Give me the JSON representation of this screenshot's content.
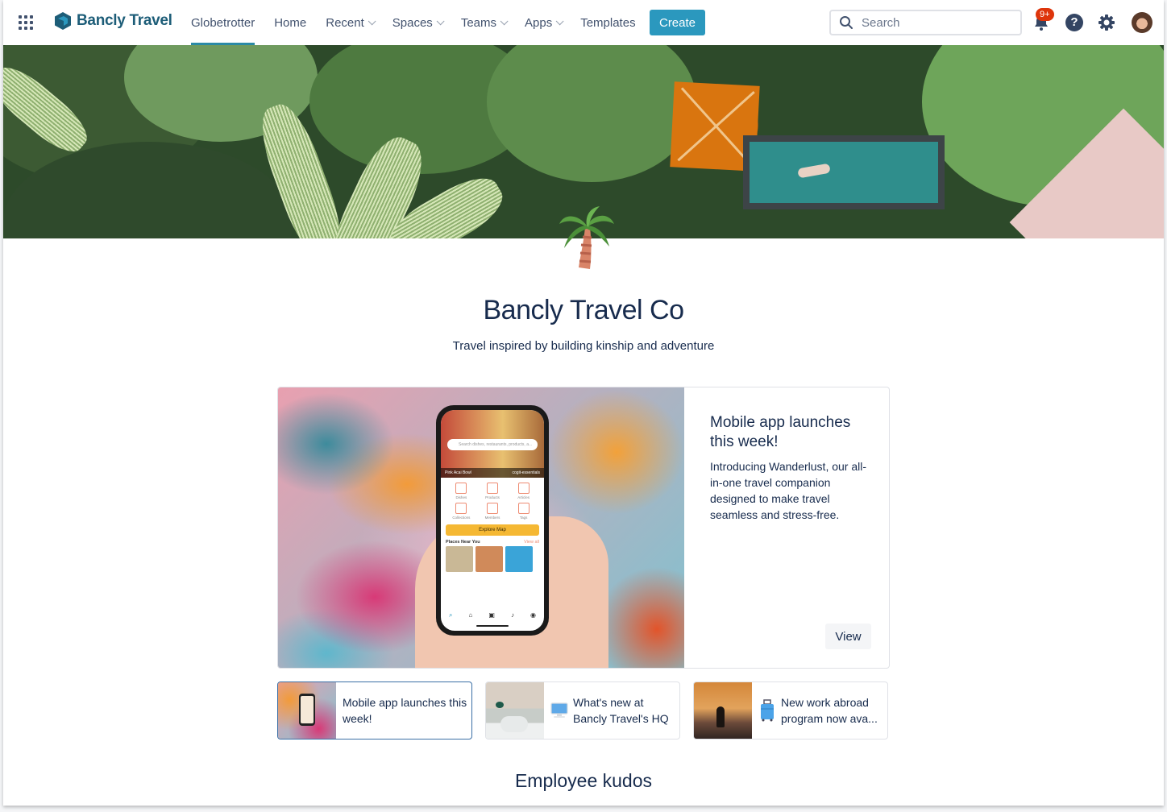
{
  "nav": {
    "brand": "Bancly Travel",
    "items": [
      {
        "label": "Globetrotter",
        "active": true,
        "dropdown": false
      },
      {
        "label": "Home",
        "active": false,
        "dropdown": false
      },
      {
        "label": "Recent",
        "active": false,
        "dropdown": true
      },
      {
        "label": "Spaces",
        "active": false,
        "dropdown": true
      },
      {
        "label": "Teams",
        "active": false,
        "dropdown": true
      },
      {
        "label": "Apps",
        "active": false,
        "dropdown": true
      },
      {
        "label": "Templates",
        "active": false,
        "dropdown": false
      }
    ],
    "create_label": "Create",
    "search_placeholder": "Search",
    "notification_count": "9+",
    "help_glyph": "?",
    "accent": "#2b98be",
    "icons": [
      "app-switcher-icon",
      "logo-icon",
      "search-icon",
      "bell-icon",
      "help-icon",
      "gear-icon",
      "avatar"
    ]
  },
  "space": {
    "emoji": "palm-tree",
    "title": "Bancly Travel Co",
    "subtitle": "Travel inspired by building kinship and adventure"
  },
  "hero": {
    "title": "Mobile app launches this week!",
    "description": "Introducing Wanderlust, our all-in-one travel companion designed to make travel seamless and stress-free.",
    "view_label": "View",
    "phone": {
      "search_placeholder": "Search dishes, restaurants, products, a...",
      "strip_left": "Pink Acai Bowl",
      "strip_right": "cogit-essentials",
      "categories": [
        "Dishes",
        "Products",
        "Articles",
        "Collections",
        "Members",
        "Tags"
      ],
      "explore_label": "Explore Map",
      "near_label": "Places Near You",
      "view_all_label": "View all"
    }
  },
  "cards": [
    {
      "title": "Mobile app launches this week!",
      "icon": "",
      "selected": true
    },
    {
      "title": "What's new at Bancly Travel's HQ",
      "icon": "computer",
      "selected": false
    },
    {
      "title": "New work abroad program now ava...",
      "icon": "luggage",
      "selected": false
    }
  ],
  "sections": {
    "kudos_title": "Employee kudos"
  }
}
